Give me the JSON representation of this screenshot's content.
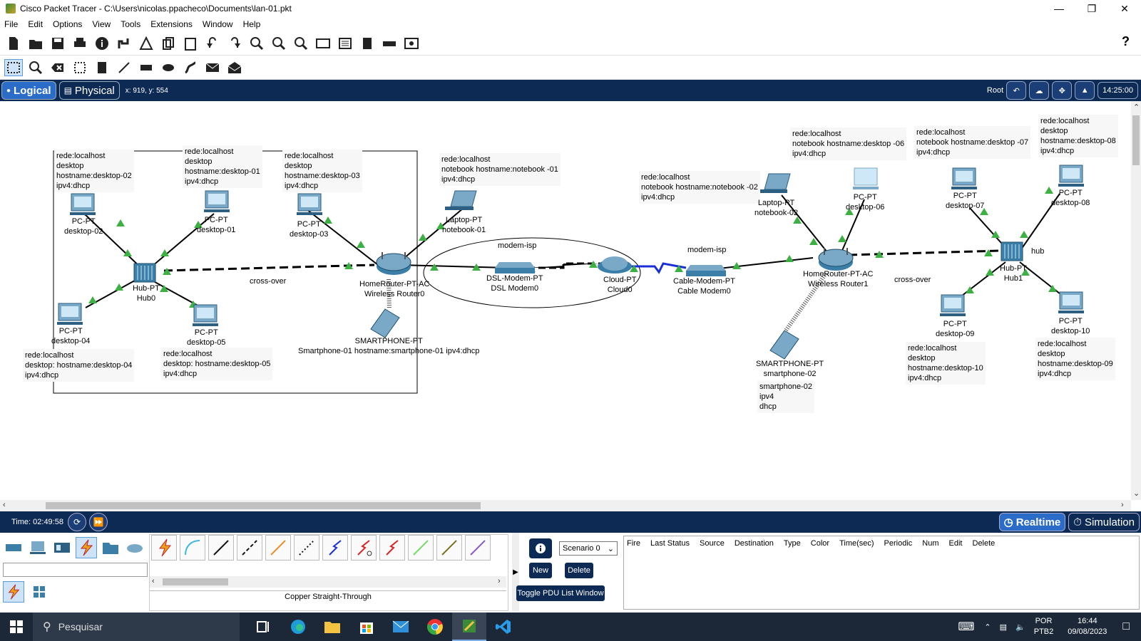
{
  "window": {
    "title": "Cisco Packet Tracer - C:\\Users\\nicolas.ppacheco\\Documents\\lan-01.pkt"
  },
  "menu": [
    "File",
    "Edit",
    "Options",
    "View",
    "Tools",
    "Extensions",
    "Window",
    "Help"
  ],
  "modebar": {
    "logical": "Logical",
    "physical": "Physical",
    "coords": "x: 919, y: 554",
    "root": "Root",
    "time": "14:25:00"
  },
  "workspace": {
    "notes": {
      "n1": "rede:localhost\ndesktop\nhostname:desktop-02\nipv4:dhcp",
      "n2": "rede:localhost\ndesktop\nhostname:desktop-01\nipv4:dhcp",
      "n3": "rede:localhost\ndesktop\nhostname:desktop-03\nipv4:dhcp",
      "n4": "rede:localhost\nnotebook hostname:notebook -01\nipv4:dhcp",
      "n5": "rede:localhost\ndesktop: hostname:desktop-04\nipv4:dhcp",
      "n6": "rede:localhost\ndesktop: hostname:desktop-05\nipv4:dhcp",
      "n7": "rede:localhost\nnotebook hostname:notebook -02\nipv4:dhcp",
      "n8": "rede:localhost\nnotebook hostname:desktop -06\nipv4:dhcp",
      "n9": "rede:localhost\nnotebook hostname:desktop -07\nipv4:dhcp",
      "n10": "rede:localhost\ndesktop\nhostname:desktop-08\nipv4:dhcp",
      "n11": "rede:localhost\ndesktop\nhostname:desktop-10\nipv4:dhcp",
      "n12": "rede:localhost\ndesktop\nhostname:desktop-09\nipv4:dhcp",
      "n13": "smartphone-02\nipv4\ndhcp"
    },
    "labels": {
      "pc02": "PC-PT\ndesktop-02",
      "pc01": "PC-PT\ndesktop-01",
      "pc03": "PC-PT\ndesktop-03",
      "lap01": "Laptop-PT\nnotebook-01",
      "hub0": "Hub-PT\nHub0",
      "pc04": "PC-PT\ndesktop-04",
      "pc05": "PC-PT\ndesktop-05",
      "router0": "HomeRouter-PT-AC\nWireless Router0",
      "sp01": "SMARTPHONE-PT\nSmartphone-01 hostname:smartphone-01 ipv4:dhcp",
      "crossover1": "cross-over",
      "modemisp1": "modem-isp",
      "dsl": "DSL-Modem-PT\nDSL Modem0",
      "cloud": "Cloud-PT\nCloud0",
      "modemisp2": "modem-isp",
      "cable": "Cable-Modem-PT\nCable Modem0",
      "lap02": "Laptop-PT\nnotebook-02",
      "pc06": "PC-PT\ndesktop-06",
      "router1": "HomeRouter-PT-AC\nWireless Router1",
      "sp02": "SMARTPHONE-PT\nsmartphone-02",
      "crossover2": "cross-over",
      "pc07": "PC-PT\ndesktop-07",
      "pc08": "PC-PT\ndesktop-08",
      "hub": "hub",
      "hub1": "Hub-PT\nHub1",
      "pc09": "PC-PT\ndesktop-09",
      "pc10": "PC-PT\ndesktop-10"
    }
  },
  "timebar": {
    "time": "Time: 02:49:58",
    "realtime": "Realtime",
    "simulation": "Simulation"
  },
  "bottom": {
    "connection_name": "Copper Straight-Through",
    "scenario": "Scenario 0",
    "new": "New",
    "delete": "Delete",
    "toggle": "Toggle PDU List Window",
    "pdu_columns": [
      "Fire",
      "Last Status",
      "Source",
      "Destination",
      "Type",
      "Color",
      "Time(sec)",
      "Periodic",
      "Num",
      "Edit",
      "Delete"
    ]
  },
  "taskbar": {
    "search": "Pesquisar",
    "lang1": "POR",
    "lang2": "PTB2",
    "clock_time": "16:44",
    "clock_date": "09/08/2023"
  },
  "colors": {
    "accent": "#0d2a55",
    "active_tab": "#2b6cc8",
    "link_green": "#3cb043"
  }
}
